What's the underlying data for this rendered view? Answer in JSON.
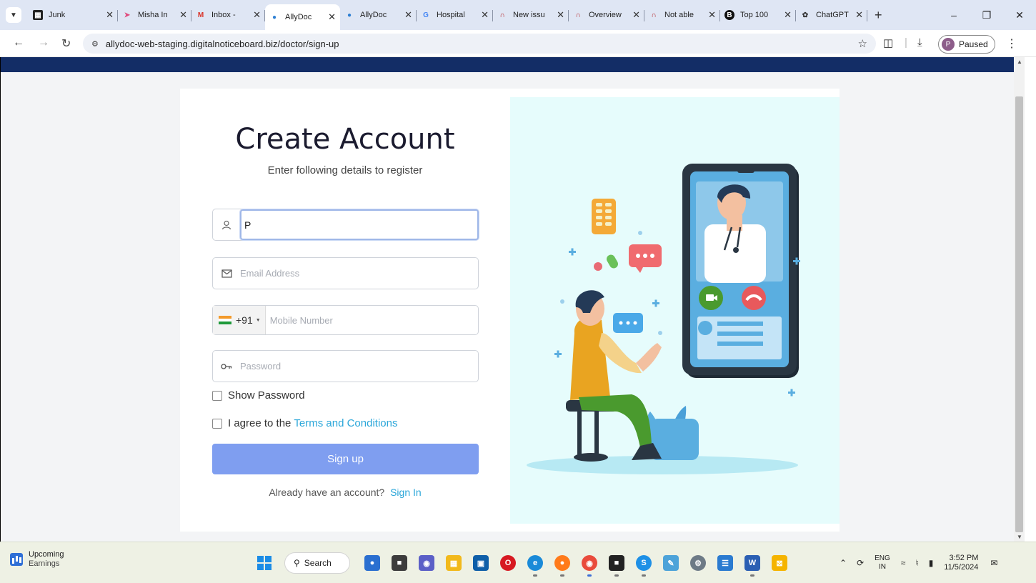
{
  "browser": {
    "tabs": [
      {
        "label": "Junk",
        "favicon": "Junk-board-icon",
        "active": false
      },
      {
        "label": "Misha In",
        "favicon": "pink-bird-icon",
        "active": false
      },
      {
        "label": "Inbox - ",
        "favicon": "gmail-icon",
        "active": false
      },
      {
        "label": "AllyDoc",
        "favicon": "allydoc-icon",
        "active": true
      },
      {
        "label": "AllyDoc",
        "favicon": "allydoc-icon",
        "active": false
      },
      {
        "label": "Hospital",
        "favicon": "google-icon",
        "active": false
      },
      {
        "label": "New issu",
        "favicon": "redmine-icon",
        "active": false
      },
      {
        "label": "Overview",
        "favicon": "redmine-icon",
        "active": false
      },
      {
        "label": "Not able",
        "favicon": "redmine-icon",
        "active": false
      },
      {
        "label": "Top 100",
        "favicon": "b-icon",
        "active": false
      },
      {
        "label": "ChatGPT",
        "favicon": "chatgpt-icon",
        "active": false
      }
    ],
    "url": "allydoc-web-staging.digitalnoticeboard.biz/doctor/sign-up",
    "profile_initial": "P",
    "profile_status": "Paused"
  },
  "form": {
    "title": "Create Account",
    "subtitle": "Enter following details to register",
    "name_value": "P",
    "email_placeholder": "Email Address",
    "country_code": "+91",
    "mobile_placeholder": "Mobile Number",
    "password_placeholder": "Password",
    "show_password_label": "Show Password",
    "agree_prefix": "I agree to the",
    "terms_link": "Terms and Conditions",
    "signup_label": "Sign up",
    "already_text": "Already have an account?",
    "signin_link": "Sign In"
  },
  "colors": {
    "header_navy": "#132d66",
    "button_blue": "#7f9ef0",
    "link_blue": "#2aa6d9",
    "illustration_bg": "#e6fcfc"
  },
  "taskbar": {
    "widget_title": "Upcoming",
    "widget_sub": "Earnings",
    "search_label": "Search",
    "lang_top": "ENG",
    "lang_bottom": "IN",
    "time": "3:52 PM",
    "date": "11/5/2024"
  }
}
